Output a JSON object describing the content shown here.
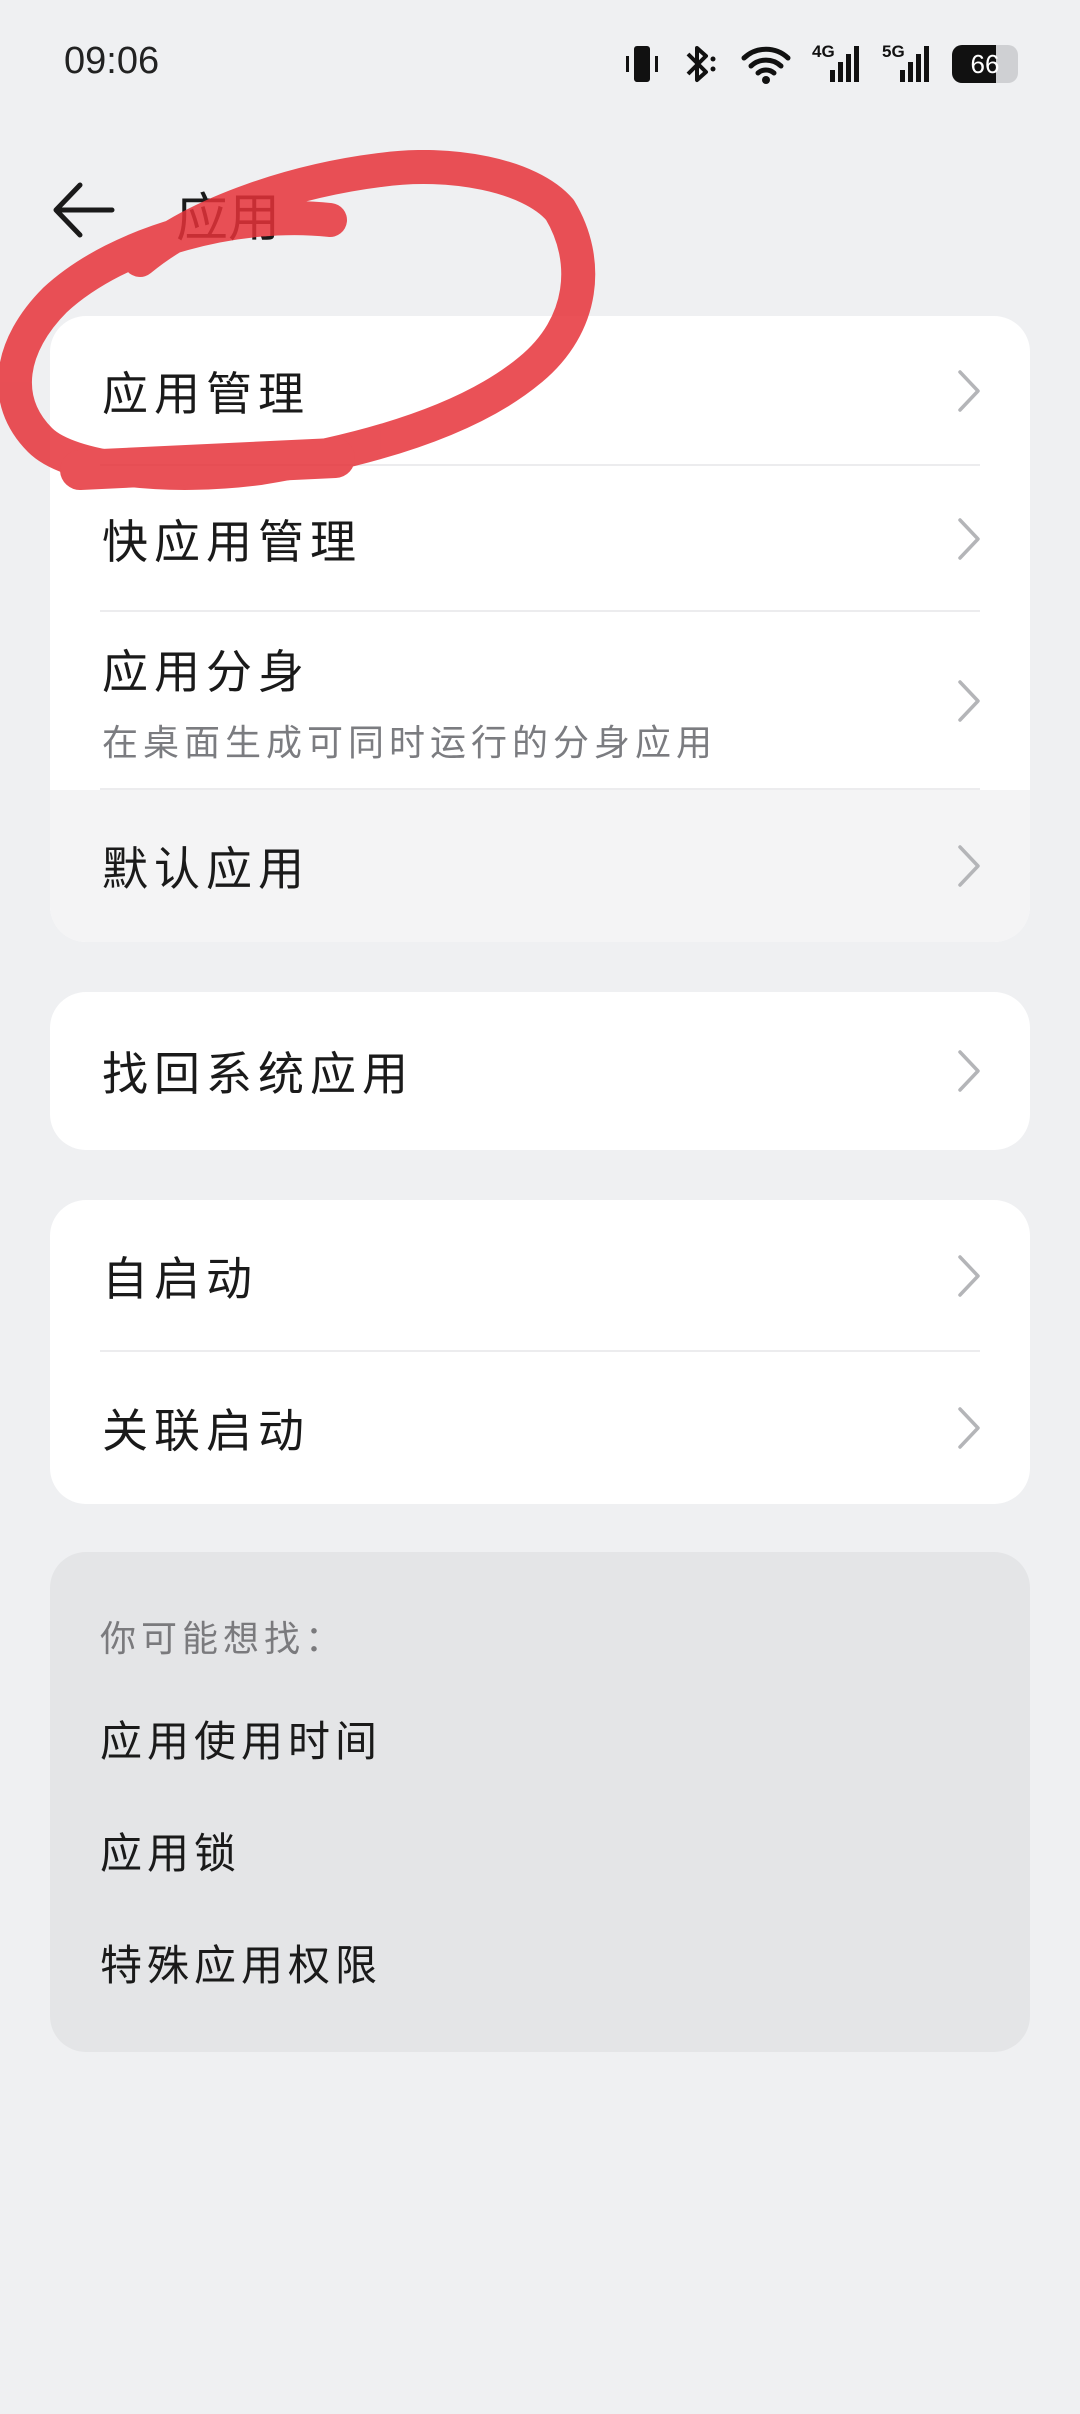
{
  "status_bar": {
    "time": "09:06",
    "network_4g": "4G",
    "network_5g": "5G",
    "battery_level": "66",
    "icons": [
      "vibrate-icon",
      "bluetooth-icon",
      "wifi-icon",
      "signal-4g-icon",
      "signal-5g-icon",
      "battery-icon"
    ]
  },
  "header": {
    "title": "应用",
    "back_icon": "arrow-left-icon"
  },
  "group1": {
    "items": [
      {
        "label": "应用管理"
      },
      {
        "label": "快应用管理"
      },
      {
        "label": "应用分身",
        "subtitle": "在桌面生成可同时运行的分身应用"
      },
      {
        "label": "默认应用"
      }
    ]
  },
  "group2": {
    "items": [
      {
        "label": "找回系统应用"
      }
    ]
  },
  "group3": {
    "items": [
      {
        "label": "自启动"
      },
      {
        "label": "关联启动"
      }
    ]
  },
  "suggestions": {
    "caption": "你可能想找：",
    "links": [
      "应用使用时间",
      "应用锁",
      "特殊应用权限"
    ]
  },
  "colors": {
    "background": "#eff0f2",
    "card": "#ffffff",
    "marker": "#e83a3f"
  }
}
